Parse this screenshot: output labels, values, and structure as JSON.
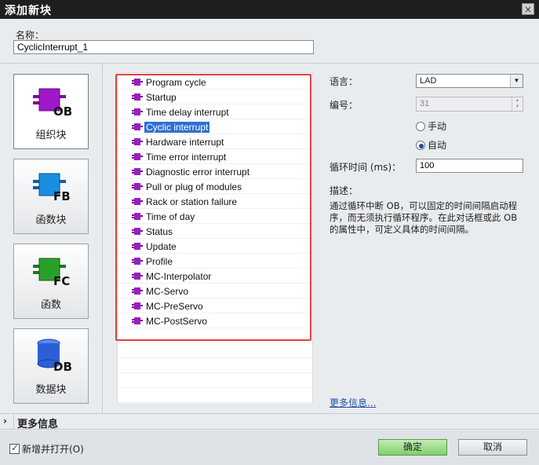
{
  "window": {
    "title": "添加新块",
    "close_glyph": "×"
  },
  "name_field": {
    "label": "名称：",
    "value": "CyclicInterrupt_1"
  },
  "block_types": [
    {
      "label": "组织块",
      "icon": "ob-block-icon",
      "tag": "OB",
      "color": "#a018c8",
      "selected": true
    },
    {
      "label": "函数块",
      "icon": "fb-block-icon",
      "tag": "FB",
      "color": "#1a8fe0",
      "selected": false
    },
    {
      "label": "函数",
      "icon": "fc-block-icon",
      "tag": "FC",
      "color": "#2aa02a",
      "selected": false
    },
    {
      "label": "数据块",
      "icon": "db-block-icon",
      "tag": "DB",
      "color": "#2c5fd6",
      "selected": false
    }
  ],
  "ob_list": {
    "selected": "Cyclic interrupt",
    "items": [
      "Program cycle",
      "Startup",
      "Time delay interrupt",
      "Cyclic interrupt",
      "Hardware interrupt",
      "Time error interrupt",
      "Diagnostic error interrupt",
      "Pull or plug of modules",
      "Rack or station failure",
      "Time of day",
      "Status",
      "Update",
      "Profile",
      "MC-Interpolator",
      "MC-Servo",
      "MC-PreServo",
      "MC-PostServo"
    ]
  },
  "properties": {
    "language_label": "语言：",
    "language_value": "LAD",
    "number_label": "编号：",
    "number_value": "31",
    "manual_label": "手动",
    "auto_label": "自动",
    "numbering_mode": "auto",
    "cycle_time_label": "循环时间 (ms)：",
    "cycle_time_value": "100",
    "description_label": "描述：",
    "description_text": "通过循环中断 OB，可以固定的时间间隔启动程序，而无须执行循环程序。在此对话框或此 OB 的属性中，可定义具体的时间间隔。",
    "more_info_link": "更多信息..."
  },
  "more_info_bar": {
    "label": "更多信息",
    "chevron": "›"
  },
  "footer": {
    "add_and_open_label": "新增并打开(O)",
    "add_and_open_checked": true,
    "ok_label": "确定",
    "cancel_label": "取消"
  },
  "colors": {
    "title_bar": "#1f1f1f",
    "highlight_box": "#e0413b",
    "selection": "#2f6fd0",
    "ok_button": "#7fcf6a",
    "ob_item_icon": "#9a1ec0"
  }
}
